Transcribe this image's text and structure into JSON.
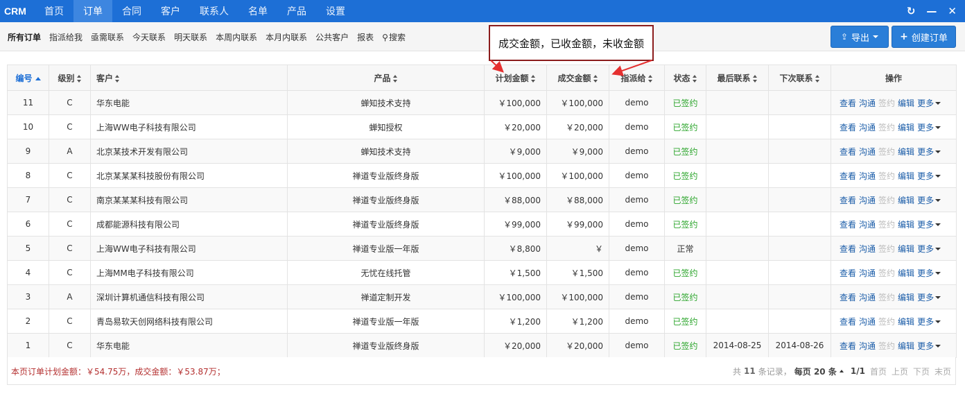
{
  "nav": {
    "brand": "CRM",
    "items": [
      "首页",
      "订单",
      "合同",
      "客户",
      "联系人",
      "名单",
      "产品",
      "设置"
    ],
    "active_index": 1,
    "window_controls": [
      "↻",
      "—",
      "✕"
    ]
  },
  "subnav": {
    "items": [
      "所有订单",
      "指派给我",
      "亟需联系",
      "今天联系",
      "明天联系",
      "本周内联系",
      "本月内联系",
      "公共客户",
      "报表"
    ],
    "search_label": "搜索",
    "search_icon": "search-icon"
  },
  "buttons": {
    "export": "导出",
    "create": "创建订单"
  },
  "annotation": {
    "text": "成交金额，已收金额，未收金额"
  },
  "table": {
    "headers": [
      "编号",
      "级别",
      "客户",
      "产品",
      "计划金额",
      "成交金额",
      "指派给",
      "状态",
      "最后联系",
      "下次联系",
      "操作"
    ],
    "rows": [
      [
        "11",
        "C",
        "华东电能",
        "蝉知技术支持",
        "￥100,000",
        "￥100,000",
        "demo",
        "已签约",
        "",
        ""
      ],
      [
        "10",
        "C",
        "上海WW电子科技有限公司",
        "蝉知授权",
        "￥20,000",
        "￥20,000",
        "demo",
        "已签约",
        "",
        ""
      ],
      [
        "9",
        "A",
        "北京某技术开发有限公司",
        "蝉知技术支持",
        "￥9,000",
        "￥9,000",
        "demo",
        "已签约",
        "",
        ""
      ],
      [
        "8",
        "C",
        "北京某某某科技股份有限公司",
        "禅道专业版终身版",
        "￥100,000",
        "￥100,000",
        "demo",
        "已签约",
        "",
        ""
      ],
      [
        "7",
        "C",
        "南京某某某科技有限公司",
        "禅道专业版终身版",
        "￥88,000",
        "￥88,000",
        "demo",
        "已签约",
        "",
        ""
      ],
      [
        "6",
        "C",
        "成都能源科技有限公司",
        "禅道专业版终身版",
        "￥99,000",
        "￥99,000",
        "demo",
        "已签约",
        "",
        ""
      ],
      [
        "5",
        "C",
        "上海WW电子科技有限公司",
        "禅道专业版一年版",
        "￥8,800",
        "￥",
        "demo",
        "正常",
        "",
        ""
      ],
      [
        "4",
        "C",
        "上海MM电子科技有限公司",
        "无忧在线托管",
        "￥1,500",
        "￥1,500",
        "demo",
        "已签约",
        "",
        ""
      ],
      [
        "3",
        "A",
        "深圳计算机通信科技有限公司",
        "禅道定制开发",
        "￥100,000",
        "￥100,000",
        "demo",
        "已签约",
        "",
        ""
      ],
      [
        "2",
        "C",
        "青岛易软天创网络科技有限公司",
        "禅道专业版一年版",
        "￥1,200",
        "￥1,200",
        "demo",
        "已签约",
        "",
        ""
      ],
      [
        "1",
        "C",
        "华东电能",
        "禅道专业版终身版",
        "￥20,000",
        "￥20,000",
        "demo",
        "已签约",
        "2014-08-25",
        "2014-08-26"
      ]
    ],
    "actions": [
      "查看",
      "沟通",
      "签约",
      "编辑",
      "更多"
    ]
  },
  "footer": {
    "summary": "本页订单计划金额：￥54.75万，成交金额：￥53.87万；",
    "total_prefix": "共",
    "total_count": "11",
    "total_suffix": "条记录，",
    "per_page_prefix": "每页",
    "per_page": "20",
    "per_page_suffix": "条",
    "page_info": "1/1",
    "pager": [
      "首页",
      "上页",
      "下页",
      "末页"
    ]
  },
  "colors": {
    "nav": "#1d6fd6",
    "signed": "#2ba52b",
    "summary": "#b43030",
    "annotation_border": "#8b1c1c",
    "arrow": "#e53030"
  }
}
